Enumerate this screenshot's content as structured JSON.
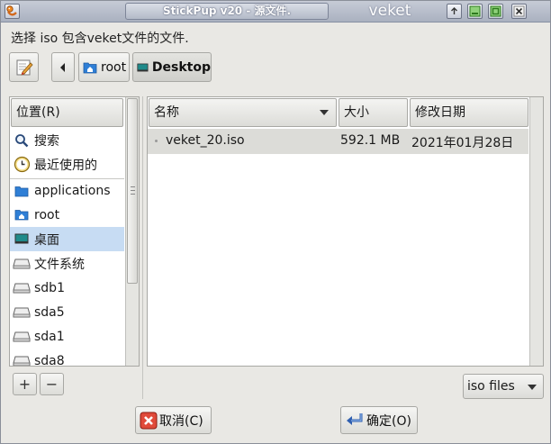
{
  "window": {
    "title": "StickPup v20 - 源文件.",
    "right_label": "veket"
  },
  "dialog": {
    "instruction": "选择 iso 包含veket文件的文件."
  },
  "path_bar": {
    "items": [
      {
        "label": "root",
        "icon": "home-folder-icon"
      },
      {
        "label": "Desktop",
        "icon": "desktop-icon"
      }
    ]
  },
  "places": {
    "header": "位置(R)",
    "items": [
      {
        "label": "搜索",
        "icon": "search-icon"
      },
      {
        "label": "最近使用的",
        "icon": "clock-icon"
      },
      {
        "label": "applications",
        "icon": "folder-icon"
      },
      {
        "label": "root",
        "icon": "home-folder-icon"
      },
      {
        "label": "桌面",
        "icon": "desktop-icon",
        "selected": true
      },
      {
        "label": "文件系统",
        "icon": "drive-icon"
      },
      {
        "label": "sdb1",
        "icon": "drive-icon"
      },
      {
        "label": "sda5",
        "icon": "drive-icon"
      },
      {
        "label": "sda1",
        "icon": "drive-icon"
      },
      {
        "label": "sda8",
        "icon": "drive-icon"
      }
    ],
    "add_label": "+",
    "remove_label": "−"
  },
  "files": {
    "columns": {
      "name": "名称",
      "size": "大小",
      "modified": "修改日期"
    },
    "rows": [
      {
        "name": "veket_20.iso",
        "size": "592.1 MB",
        "modified": "2021年01月28日"
      }
    ]
  },
  "filter": {
    "selected": "iso files"
  },
  "actions": {
    "cancel_label": "取消(C)",
    "ok_label": "确定(O)"
  },
  "colors": {
    "selection": "#c7dcf3",
    "titlebar": "#aab1c0"
  }
}
